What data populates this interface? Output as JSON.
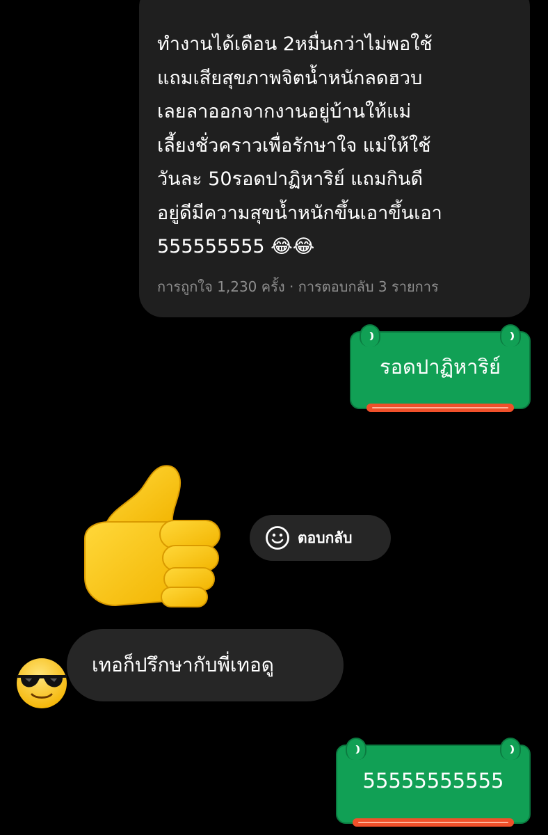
{
  "post": {
    "text": "ทำงานได้เดือน 2หมื่นกว่าไม่พอใช้\nแถมเสียสุขภาพจิตน้ำหนักลดฮวบ\nเลยลาออกจากงานอยู่บ้านให้แม่\nเลี้ยงชั่วคราวเพื่อรักษาใจ แม่ให้ใช้\nวันละ 50รอดปาฏิหาริย์ แถมกินดี\nอยู่ดีมีความสุขน้ำหนักขึ้นเอาขึ้นเอา\n555555555 😂😂",
    "meta": "การถูกใจ 1,230 ครั้ง · การตอบกลับ 3 รายการ"
  },
  "messages": {
    "sticker_1": "รอดปาฏิหาริย์",
    "reply_label": "ตอบกลับ",
    "incoming_text": "เทอก็ปรึกษากับพี่เทอดู",
    "sticker_2": "55555555555"
  },
  "icons": {
    "thumbs": "thumbs-up-emoji",
    "reply": "smiley-outline-icon",
    "avatar": "sunglasses-emoji"
  },
  "colors": {
    "background": "#000000",
    "bubble": "#1f1f1f",
    "chip": "#262626",
    "sticker_green": "#11a055",
    "sticker_stripe": "#f0502a",
    "meta_text": "#8e8e8e"
  }
}
